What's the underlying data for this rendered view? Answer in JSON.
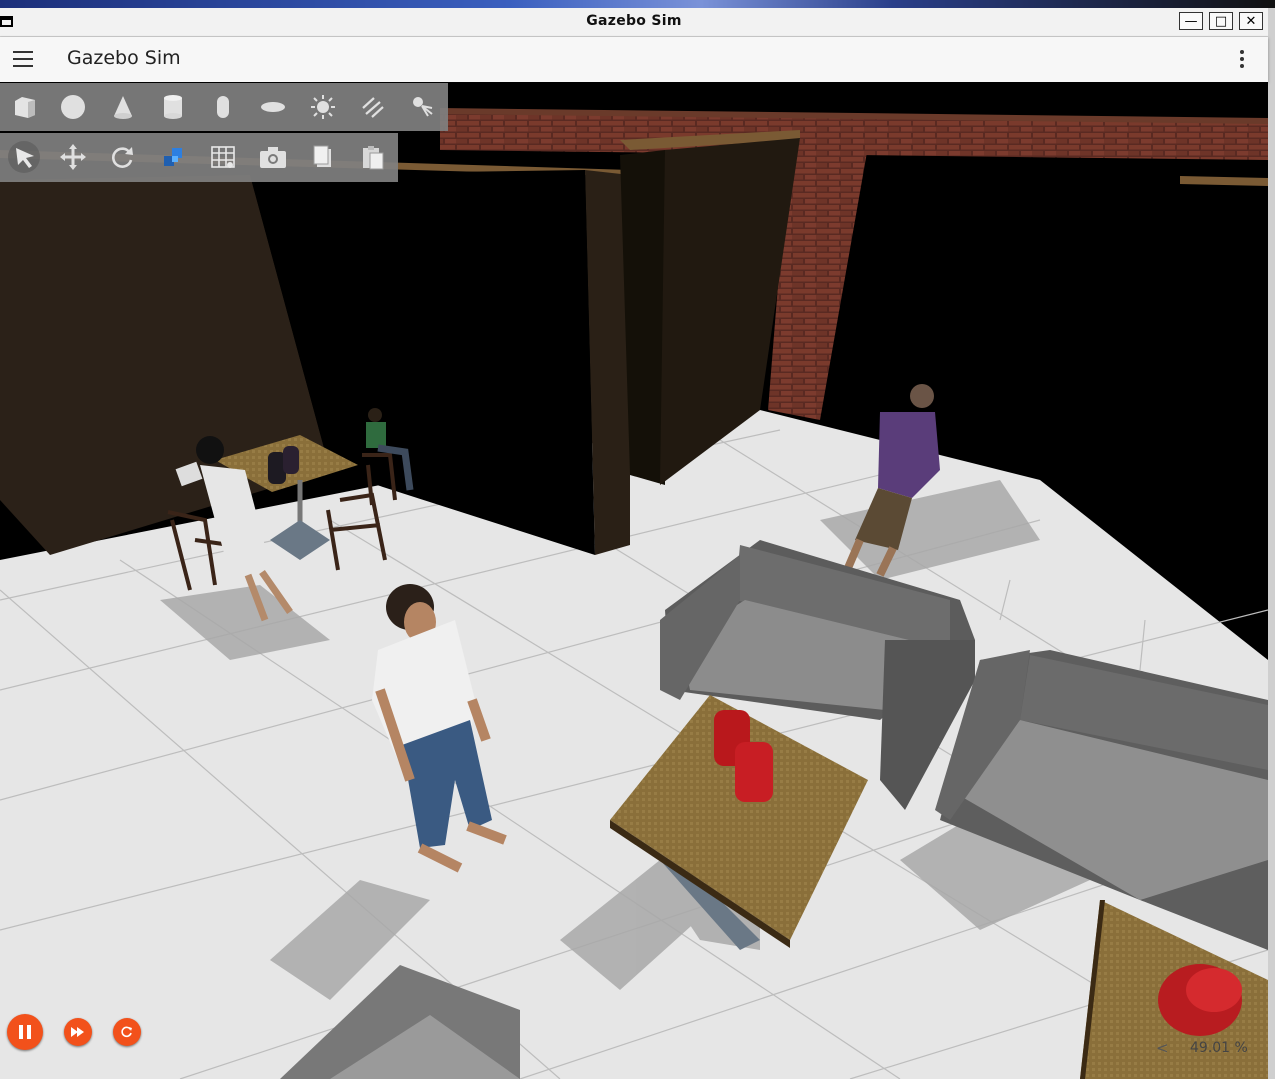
{
  "window": {
    "title": "Gazebo Sim"
  },
  "appbar": {
    "title": "Gazebo Sim"
  },
  "shapes_toolbar": {
    "items": [
      "box",
      "sphere",
      "cone",
      "cylinder",
      "capsule",
      "ellipsoid",
      "point-light",
      "directional-light",
      "spot-light"
    ]
  },
  "transform_toolbar": {
    "items": [
      "select",
      "translate",
      "rotate",
      "snap",
      "grid",
      "screenshot",
      "copy",
      "paste"
    ],
    "selected": "select"
  },
  "playback": {
    "state": "running"
  },
  "real_time_factor": {
    "value": "49.01 %",
    "arrow": "<"
  },
  "colors": {
    "accent": "#f2511b",
    "toolbar_bg": "#808080",
    "floor": "#e8e8e8",
    "wall": "#000000"
  }
}
